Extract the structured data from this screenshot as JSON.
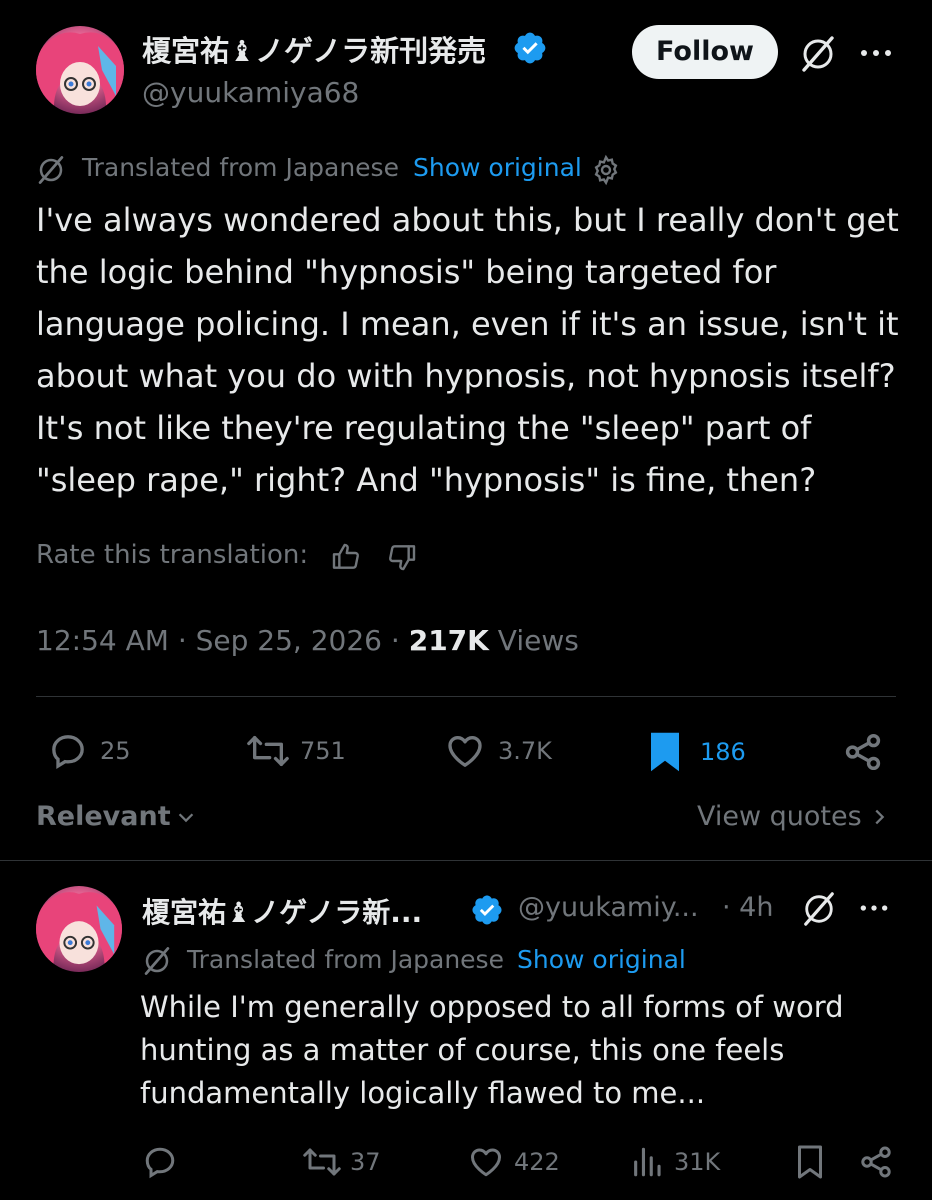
{
  "tweet": {
    "author": {
      "name": "榎宮祐♝ノゲノラ新刊発売",
      "handle": "@yuukamiya68",
      "verified": true
    },
    "follow_label": "Follow",
    "translation": {
      "label": "Translated from Japanese",
      "show_original": "Show original"
    },
    "text": "I've always wondered about this, but I really don't get the logic behind \"hypnosis\" being targeted for language policing. I mean, even if it's an issue, isn't it about what you do with hypnosis, not hypnosis itself? It's not like they're regulating the \"sleep\" part of \"sleep rape,\" right? And \"hypnosis\" is fine, then?",
    "rate_translation": "Rate this translation:",
    "time": "12:54 AM",
    "date": "Sep 25, 2026",
    "views_count": "217K",
    "views_label": "Views",
    "dot": "·",
    "stats": {
      "replies": "25",
      "reposts": "751",
      "likes": "3.7K",
      "bookmarks": "186"
    },
    "relevant_label": "Relevant",
    "view_quotes_label": "View quotes"
  },
  "reply": {
    "author": {
      "name": "榎宮祐♝ノゲノラ新...",
      "handle": "@yuukamiy...",
      "verified": true,
      "time": "· 4h"
    },
    "translation": {
      "label": "Translated from Japanese",
      "show_original": "Show original"
    },
    "text": "While I'm generally opposed to all forms of word hunting as a matter of course, this one feels fundamentally logically flawed to me...",
    "stats": {
      "replies": "",
      "reposts": "37",
      "likes": "422",
      "views": "31K"
    }
  },
  "colors": {
    "background": "#000000",
    "text": "#e7e9ea",
    "muted": "#71767b",
    "accent": "#1d9bf0",
    "divider": "#2f3336"
  }
}
